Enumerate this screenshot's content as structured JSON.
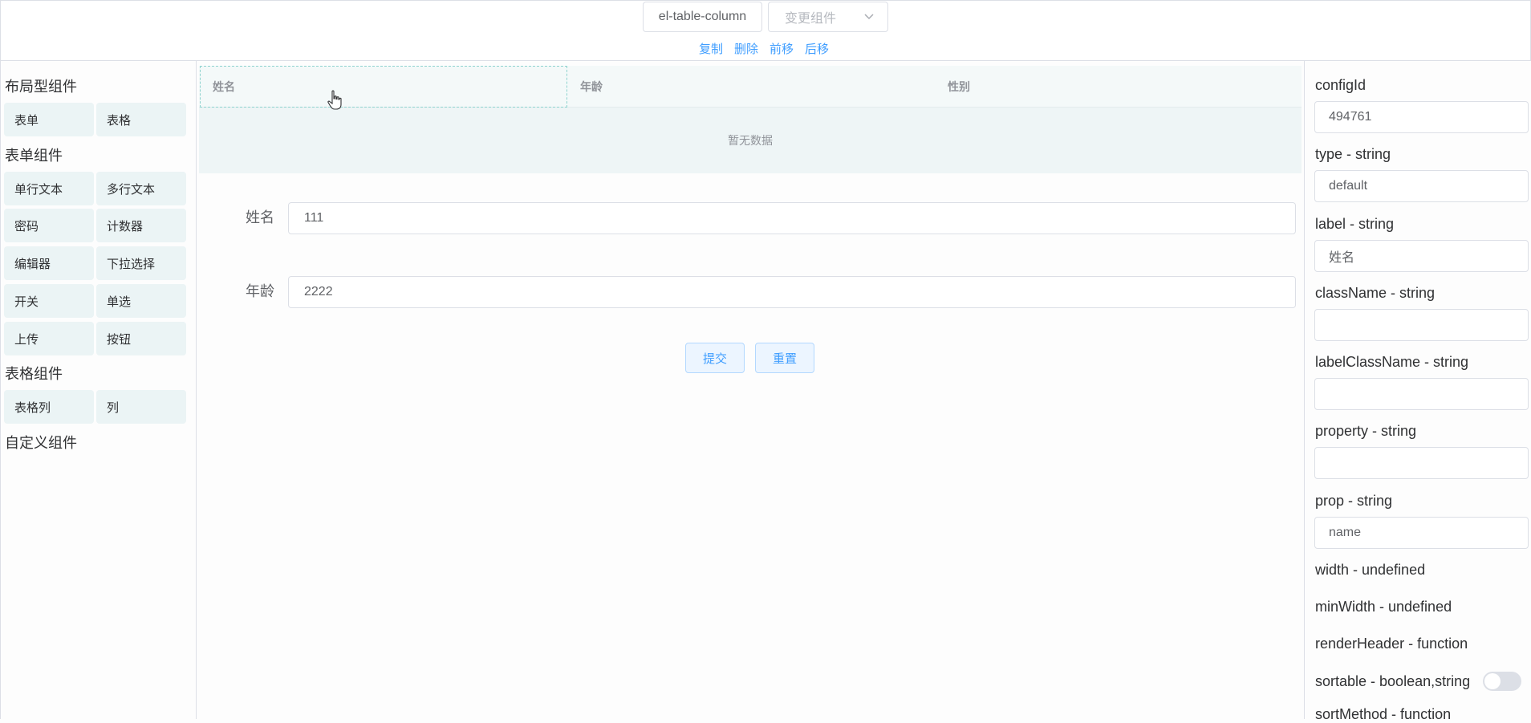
{
  "toolbar": {
    "component_type": "el-table-column",
    "change_component_placeholder": "变更组件",
    "actions": [
      "复制",
      "删除",
      "前移",
      "后移"
    ]
  },
  "palette": {
    "layout_title": "布局型组件",
    "layout_items": [
      "表单",
      "表格"
    ],
    "form_title": "表单组件",
    "form_items": [
      "单行文本",
      "多行文本",
      "密码",
      "计数器",
      "编辑器",
      "下拉选择",
      "开关",
      "单选",
      "上传",
      "按钮"
    ],
    "table_title": "表格组件",
    "table_items": [
      "表格列",
      "列"
    ],
    "custom_title": "自定义组件"
  },
  "canvas": {
    "table": {
      "columns": [
        "姓名",
        "年龄",
        "性别"
      ],
      "empty_text": "暂无数据"
    },
    "form": {
      "fields": [
        {
          "label": "姓名",
          "value": "111"
        },
        {
          "label": "年龄",
          "value": "2222"
        }
      ],
      "submit_label": "提交",
      "reset_label": "重置"
    }
  },
  "props": {
    "items": [
      {
        "label": "configId",
        "value": "494761"
      },
      {
        "label": "type - string",
        "value": "default"
      },
      {
        "label": "label - string",
        "value": "姓名"
      },
      {
        "label": "className - string",
        "value": ""
      },
      {
        "label": "labelClassName - string",
        "value": ""
      },
      {
        "label": "property - string",
        "value": ""
      },
      {
        "label": "prop - string",
        "value": "name"
      }
    ],
    "static_items": [
      "width - undefined",
      "minWidth - undefined",
      "renderHeader - function"
    ],
    "sortable_label": "sortable - boolean,string",
    "sortable_on": false,
    "sort_method_label": "sortMethod - function"
  },
  "colors": {
    "accent": "#409eff",
    "palette_button_bg": "#ebf4f5",
    "table_bg": "#eef5f6"
  }
}
